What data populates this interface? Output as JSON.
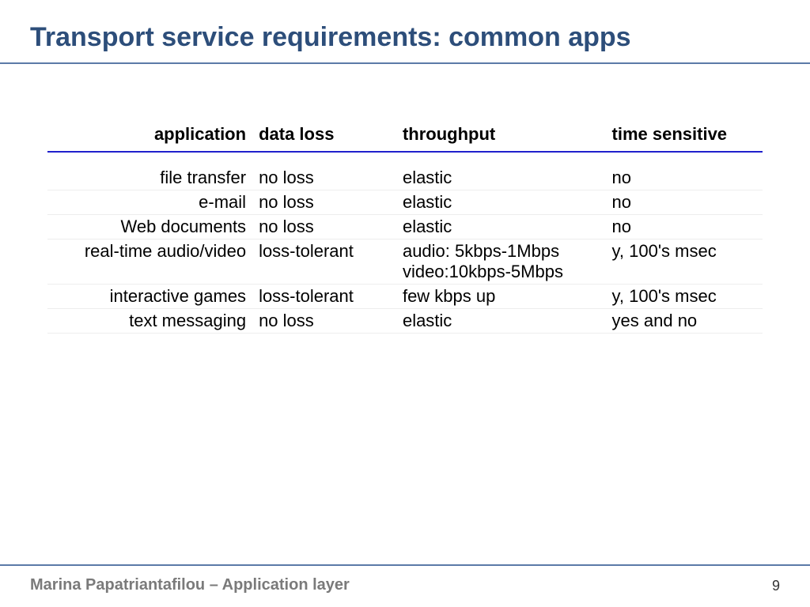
{
  "title": "Transport service requirements: common apps",
  "table": {
    "headers": {
      "application": "application",
      "data_loss": "data loss",
      "throughput": "throughput",
      "time_sensitive": "time sensitive"
    },
    "rows": [
      {
        "application": "file transfer",
        "data_loss": "no loss",
        "throughput": "elastic",
        "time_sensitive": "no"
      },
      {
        "application": "e-mail",
        "data_loss": "no loss",
        "throughput": "elastic",
        "time_sensitive": "no"
      },
      {
        "application": "Web documents",
        "data_loss": "no loss",
        "throughput": "elastic",
        "time_sensitive": "no"
      },
      {
        "application": "real-time audio/video",
        "data_loss": "loss-tolerant",
        "throughput": "audio: 5kbps-1Mbps video:10kbps-5Mbps",
        "time_sensitive": "y, 100's msec"
      },
      {
        "application": "interactive games",
        "data_loss": "loss-tolerant",
        "throughput": "few kbps up",
        "time_sensitive": "y, 100's msec"
      },
      {
        "application": "text messaging",
        "data_loss": "no loss",
        "throughput": "elastic",
        "time_sensitive": "yes and no"
      }
    ]
  },
  "footer": "Marina Papatriantafilou –  Application layer",
  "page_number": "9",
  "chart_data": {
    "type": "table",
    "title": "Transport service requirements: common apps",
    "columns": [
      "application",
      "data loss",
      "throughput",
      "time sensitive"
    ],
    "rows": [
      [
        "file transfer",
        "no loss",
        "elastic",
        "no"
      ],
      [
        "e-mail",
        "no loss",
        "elastic",
        "no"
      ],
      [
        "Web documents",
        "no loss",
        "elastic",
        "no"
      ],
      [
        "real-time audio/video",
        "loss-tolerant",
        "audio: 5kbps-1Mbps video:10kbps-5Mbps",
        "y, 100's msec"
      ],
      [
        "interactive games",
        "loss-tolerant",
        "few kbps up",
        "y, 100's msec"
      ],
      [
        "text messaging",
        "no loss",
        "elastic",
        "yes and no"
      ]
    ]
  }
}
